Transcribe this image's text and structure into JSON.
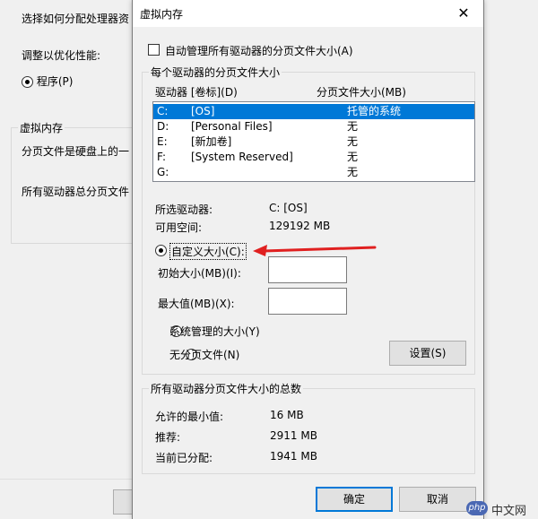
{
  "background_window": {
    "intro_text": "选择如何分配处理器资",
    "adjust_label": "调整以优化性能:",
    "program_option": "程序(P)",
    "vm_group_title": "虚拟内存",
    "vm_text_1": "分页文件是硬盘上的一",
    "vm_text_2": "所有驱动器总分页文件"
  },
  "dialog": {
    "title": "虚拟内存",
    "close_glyph": "✕",
    "auto_manage_label": "自动管理所有驱动器的分页文件大小(A)",
    "per_drive_group_title": "每个驱动器的分页文件大小",
    "drive_col_header": "驱动器 [卷标](D)",
    "size_col_header": "分页文件大小(MB)",
    "drives": [
      {
        "letter": "C:",
        "label": "[OS]",
        "size": "托管的系统",
        "selected": true
      },
      {
        "letter": "D:",
        "label": "[Personal Files]",
        "size": "无",
        "selected": false
      },
      {
        "letter": "E:",
        "label": "[新加卷]",
        "size": "无",
        "selected": false
      },
      {
        "letter": "F:",
        "label": "[System Reserved]",
        "size": "无",
        "selected": false
      },
      {
        "letter": "G:",
        "label": "",
        "size": "无",
        "selected": false
      }
    ],
    "selected_drive_label": "所选驱动器:",
    "selected_drive_value": "C:  [OS]",
    "free_space_label": "可用空间:",
    "free_space_value": "129192 MB",
    "custom_size_label": "自定义大小(C):",
    "initial_size_label": "初始大小(MB)(I):",
    "initial_size_value": "",
    "max_size_label": "最大值(MB)(X):",
    "max_size_value": "",
    "system_managed_label": "系统管理的大小(Y)",
    "no_paging_label": "无分页文件(N)",
    "set_button": "设置(S)",
    "totals_group_title": "所有驱动器分页文件大小的总数",
    "min_allowed_label": "允许的最小值:",
    "min_allowed_value": "16 MB",
    "recommended_label": "推荐:",
    "recommended_value": "2911 MB",
    "currently_allocated_label": "当前已分配:",
    "currently_allocated_value": "1941 MB",
    "ok_button": "确定",
    "cancel_button": "取消"
  },
  "watermark": {
    "badge": "php",
    "text": "中文网"
  },
  "colors": {
    "selection": "#0078d7",
    "arrow": "#e02020",
    "dialog_bg": "#f0f0f0"
  }
}
